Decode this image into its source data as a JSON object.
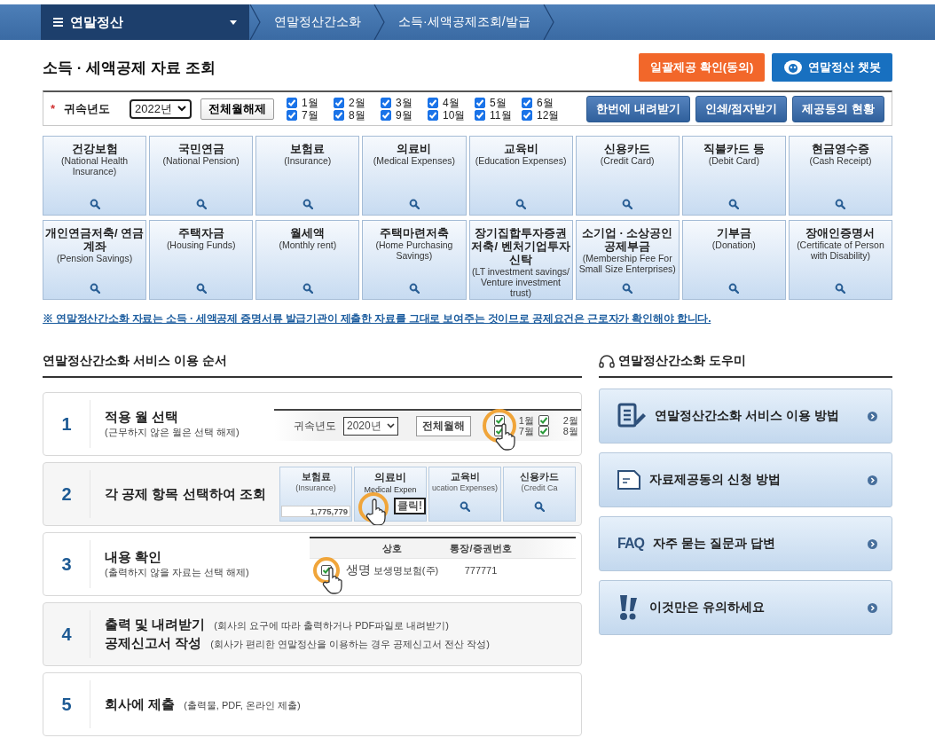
{
  "nav": {
    "menu": "연말정산",
    "breadcrumbs": [
      "연말정산간소화",
      "소득·세액공제조회/발급"
    ]
  },
  "page_title": "소득 · 세액공제 자료 조회",
  "header_buttons": [
    {
      "label": "일괄제공 확인(동의)",
      "kind": "consent"
    },
    {
      "label": "연말정산 챗봇",
      "kind": "chatbot"
    }
  ],
  "filter": {
    "required_mark": "*",
    "label": "귀속년도",
    "year": "2022년",
    "toggle_all": "전체월해제",
    "months": [
      {
        "label": "1월",
        "checked": true
      },
      {
        "label": "7월",
        "checked": true
      },
      {
        "label": "2월",
        "checked": true
      },
      {
        "label": "8월",
        "checked": true
      },
      {
        "label": "3월",
        "checked": true
      },
      {
        "label": "9월",
        "checked": true
      },
      {
        "label": "4월",
        "checked": true
      },
      {
        "label": "10월",
        "checked": true
      },
      {
        "label": "5월",
        "checked": true
      },
      {
        "label": "11월",
        "checked": true
      },
      {
        "label": "6월",
        "checked": true
      },
      {
        "label": "12월",
        "checked": true
      }
    ],
    "actions": [
      "한번에 내려받기",
      "인쇄/점자받기",
      "제공동의 현황"
    ]
  },
  "categories": [
    {
      "name": "건강보험",
      "english": "(National Health Insurance)"
    },
    {
      "name": "국민연금",
      "english": "(National Pension)"
    },
    {
      "name": "보험료",
      "english": "(Insurance)"
    },
    {
      "name": "의료비",
      "english": "(Medical Expenses)"
    },
    {
      "name": "교육비",
      "english": "(Education Expenses)"
    },
    {
      "name": "신용카드",
      "english": "(Credit Card)"
    },
    {
      "name": "직불카드 등",
      "english": "(Debit Card)"
    },
    {
      "name": "현금영수증",
      "english": "(Cash Receipt)"
    },
    {
      "name": "개인연금저축/ 연금계좌",
      "english": "(Pension Savings)"
    },
    {
      "name": "주택자금",
      "english": "(Housing Funds)"
    },
    {
      "name": "월세액",
      "english": "(Monthly rent)"
    },
    {
      "name": "주택마련저축",
      "english": "(Home Purchasing Savings)"
    },
    {
      "name": "장기집합투자증권저축/ 벤처기업투자신탁",
      "english": "(LT investment savings/ Venture investment trust)"
    },
    {
      "name": "소기업 · 소상공인 공제부금",
      "english": "(Membership Fee For Small Size Enterprises)"
    },
    {
      "name": "기부금",
      "english": "(Donation)"
    },
    {
      "name": "장애인증명서",
      "english": "(Certificate of Person with Disability)"
    }
  ],
  "notice": "※ 연말정산간소화 자료는 소득 · 세액공제 증명서류 발급기관이 제출한 자료를 그대로 보여주는 것이므로 공제요건은 근로자가 확인해야 합니다.",
  "steps_title": "연말정산간소화 서비스 이용 순서",
  "steps": [
    {
      "number": "1",
      "kind": "stacked",
      "lines": [
        {
          "title": "적용 월 선택",
          "note": "(근무하지 않은 월은 선택 해제)"
        }
      ],
      "illustration": {
        "kind": "months",
        "label": "귀속년도",
        "year": "2020년",
        "button": "전체월해",
        "months": [
          {
            "label": "1월",
            "checked": true
          },
          {
            "label": "7월",
            "checked": true
          },
          {
            "label": "2월",
            "checked": true
          },
          {
            "label": "8월",
            "checked": true
          }
        ]
      }
    },
    {
      "number": "2",
      "kind": "stacked",
      "lines": [
        {
          "title": "각 공제 항목 선택하여 조회"
        }
      ],
      "illustration": {
        "kind": "tiles",
        "callout": "클릭!",
        "tiles": [
          {
            "name": "보험료",
            "english": "(Insurance)",
            "amount": "1,775,779"
          },
          {
            "name": "의료비",
            "english": "Medical Expen"
          },
          {
            "name": "교육비",
            "english": "ucation Expenses)"
          },
          {
            "name": "신용카드",
            "english": "(Credit Ca"
          }
        ]
      }
    },
    {
      "number": "3",
      "kind": "stacked",
      "lines": [
        {
          "title": "내용 확인",
          "note": "(출력하지 않을 자료는 선택 해제)"
        }
      ],
      "illustration": {
        "kind": "table",
        "columns": [
          "상호",
          "통장/증권번호"
        ],
        "rows": [
          {
            "checked": true,
            "zoomed": "생명",
            "cells": [
              "보생명보험(주)",
              "777771"
            ]
          }
        ]
      }
    },
    {
      "number": "4",
      "kind": "inline",
      "lines": [
        {
          "title": "출력 및 내려받기",
          "note": "(회사의 요구에 따라 출력하거나 PDF파일로 내려받기)"
        },
        {
          "title": "공제신고서 작성",
          "note": "(회사가 편리한 연말정산을 이용하는 경우 공제신고서 전산 작성)"
        }
      ]
    },
    {
      "number": "5",
      "kind": "inline",
      "lines": [
        {
          "title": "회사에 제출",
          "note": "(출력물, PDF, 온라인 제출)"
        }
      ]
    }
  ],
  "helper": {
    "title": "연말정산간소화 도우미",
    "items": [
      {
        "label": "연말정산간소화 서비스 이용 방법",
        "kind": "guide"
      },
      {
        "label": "자료제공동의 신청 방법",
        "kind": "form"
      },
      {
        "label": "자주 묻는 질문과 답변",
        "kind": "faq",
        "badge": "FAQ"
      },
      {
        "label": "이것만은 유의하세요",
        "kind": "alert"
      }
    ]
  }
}
